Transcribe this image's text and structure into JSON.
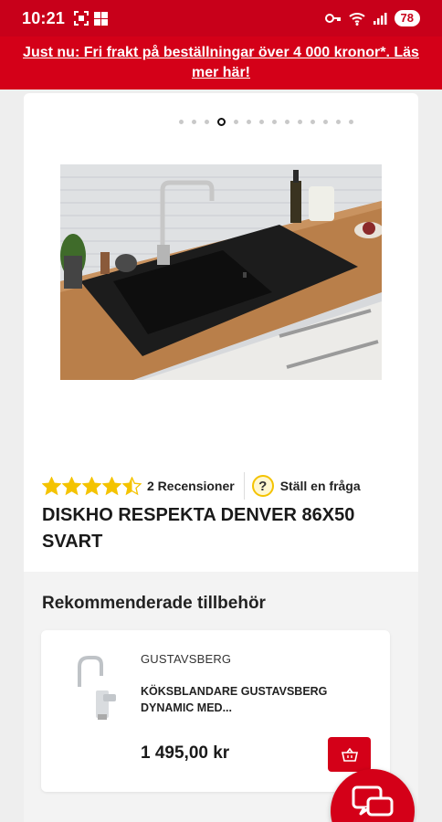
{
  "status_bar": {
    "time": "10:21",
    "battery": "78",
    "icons": [
      "screenshot-icon",
      "windows-icon",
      "key-icon",
      "wifi-icon",
      "signal-icon"
    ]
  },
  "promo_banner": {
    "text": "Just nu: Fri frakt på beställningar över 4 000 kronor*. Läs mer här!"
  },
  "carousel": {
    "dot_count": 14,
    "active_index": 3
  },
  "product": {
    "rating": 4.5,
    "rating_max": 5,
    "reviews_label": "2 Recensioner",
    "ask_label": "Ställ en fråga",
    "title": "DISKHO RESPEKTA DENVER 86X50 SVART"
  },
  "accessories": {
    "heading": "Rekommenderade tillbehör",
    "items": [
      {
        "brand": "GUSTAVSBERG",
        "name": "KÖKSBLANDARE GUSTAVSBERG DYNAMIC MED...",
        "price": "1 495,00 kr"
      }
    ]
  },
  "colors": {
    "brand_red": "#d40018",
    "star_yellow": "#f4c300"
  }
}
